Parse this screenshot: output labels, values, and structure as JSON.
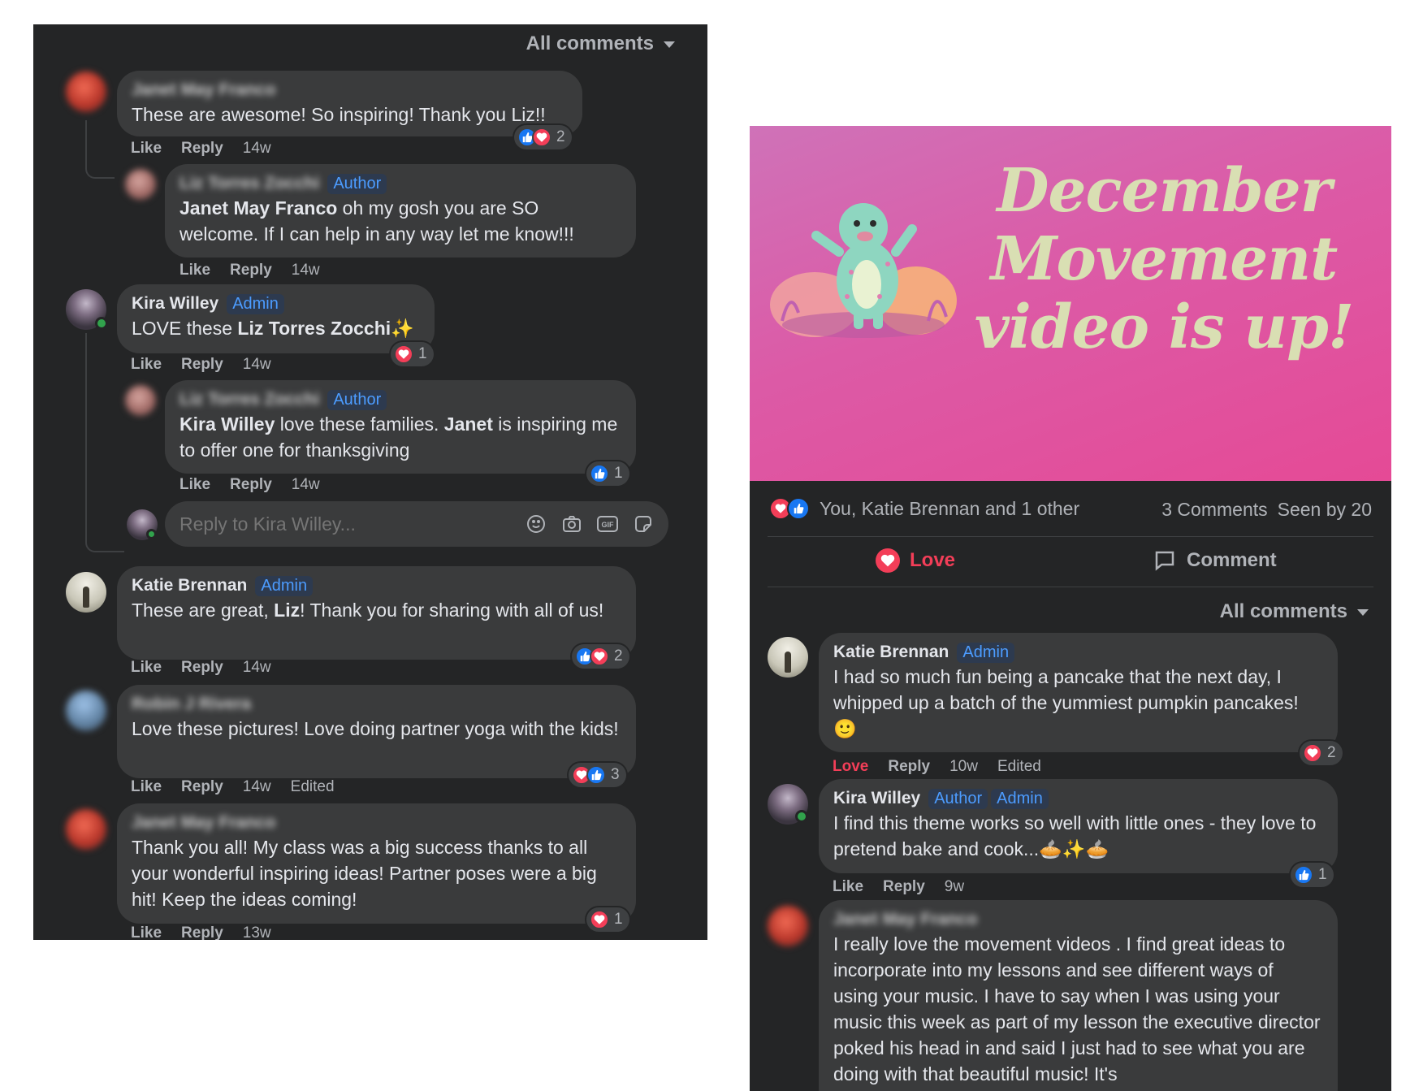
{
  "left_panel": {
    "sort_label": "All comments",
    "comments": [
      {
        "name": "Janet May Franco",
        "text": "These are awesome! So inspiring! Thank you Liz!!",
        "like": "Like",
        "reply": "Reply",
        "time": "14w",
        "reaction_count": "2"
      },
      {
        "name": "Liz Torres Zocchi",
        "badge": "Author",
        "mention": "Janet May Franco",
        "text": " oh my gosh you are SO welcome. If I can help in any way let me know!!!",
        "like": "Like",
        "reply": "Reply",
        "time": "14w"
      },
      {
        "name": "Kira Willey",
        "badge": "Admin",
        "text_pre": "LOVE these ",
        "mention": "Liz Torres Zocchi",
        "emoji": "✨",
        "like": "Like",
        "reply": "Reply",
        "time": "14w",
        "reaction_count": "1"
      },
      {
        "name": "Liz Torres Zocchi",
        "badge": "Author",
        "mention": "Kira Willey",
        "text_mid": " love these families. ",
        "mention2": "Janet",
        "text_end": " is inspiring me to offer one for thanksgiving",
        "like": "Like",
        "reply": "Reply",
        "time": "14w",
        "reaction_count": "1"
      },
      {
        "name": "Katie Brennan",
        "badge": "Admin",
        "text_pre": "These are great, ",
        "mention": "Liz",
        "text_end": "! Thank you for sharing with all of us!",
        "like": "Like",
        "reply": "Reply",
        "time": "14w",
        "reaction_count": "2"
      },
      {
        "name": "Robin J Rivera",
        "text": "Love these pictures! Love doing partner yoga with the kids!",
        "like": "Like",
        "reply": "Reply",
        "time": "14w",
        "edited": "Edited",
        "reaction_count": "3"
      },
      {
        "name": "Janet May Franco",
        "text": "Thank you all! My class was a big success thanks to all your wonderful inspiring ideas! Partner poses were a big hit! Keep the ideas coming!",
        "like": "Like",
        "reply": "Reply",
        "time": "13w",
        "reaction_count": "1"
      }
    ],
    "reply_placeholder": "Reply to Kira Willey..."
  },
  "right_panel": {
    "banner_line1": "December",
    "banner_line2": "Movement",
    "banner_line3": "video is up!",
    "reactions_summary": "You, Katie Brennan and 1 other",
    "comment_count": "3 Comments",
    "seen_by": "Seen by 20",
    "love_label": "Love",
    "comment_label": "Comment",
    "sort_label": "All comments",
    "comments": [
      {
        "name": "Katie Brennan",
        "badge": "Admin",
        "text": "I had so much fun being a pancake that the next day, I whipped up a batch of the yummiest pumpkin pancakes! 🙂",
        "love": "Love",
        "reply": "Reply",
        "time": "10w",
        "edited": "Edited",
        "reaction_count": "2"
      },
      {
        "name": "Kira Willey",
        "badge": "Author",
        "badge2": "Admin",
        "text": "I find this theme works so well with little ones - they love to pretend bake and cook...🥧✨🥧",
        "like": "Like",
        "reply": "Reply",
        "time": "9w",
        "reaction_count": "1"
      },
      {
        "name": "Janet May Franco",
        "text": "I really love the movement videos . I find great ideas to incorporate into my lessons and see different ways of using your music. I have to say when I was using your music this week as part of my lesson the executive director poked his head in and said I just had to see what you are doing with that beautiful music! It's"
      }
    ]
  },
  "colors": {
    "panel_bg": "#242526",
    "bubble_bg": "#3a3b3c",
    "love_red": "#f33e58",
    "like_blue": "#1877f2",
    "badge_blue": "#4c9cff",
    "banner_pink": "#e05aa4"
  }
}
